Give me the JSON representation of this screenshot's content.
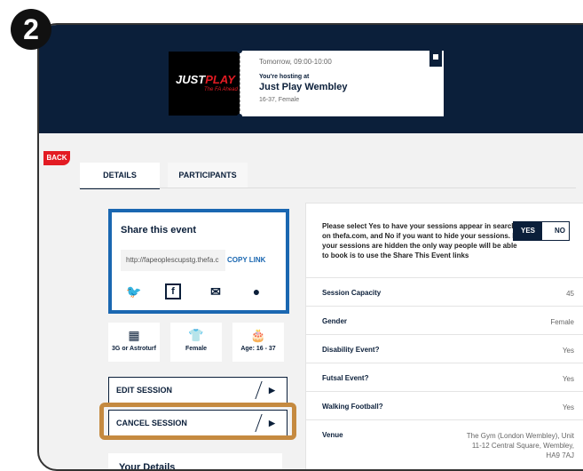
{
  "step_badge": "2",
  "header": {
    "logo_main": "JUST",
    "logo_accent": "PLAY",
    "logo_sub": "The FA Ahead",
    "ticket": {
      "time": "Tomorrow, 09:00-10:00",
      "hosting_label": "You're hosting at",
      "title": "Just Play Wembley",
      "meta": "16-37, Female"
    }
  },
  "nav": {
    "back_label": "BACK",
    "tabs": [
      {
        "label": "DETAILS",
        "active": true
      },
      {
        "label": "PARTICIPANTS",
        "active": false
      }
    ]
  },
  "share": {
    "title": "Share this event",
    "link": "http://fapeoplescupstg.thefa.c",
    "copy_label": "COPY LINK",
    "icons": [
      "twitter-icon",
      "facebook-icon",
      "email-icon",
      "whatsapp-icon"
    ]
  },
  "info_tiles": [
    {
      "icon": "pitch-icon",
      "label": "3G or Astroturf"
    },
    {
      "icon": "shirt-icon",
      "label": "Female"
    },
    {
      "icon": "cake-icon",
      "label": "Age: 16 - 37"
    }
  ],
  "actions": {
    "edit_label": "EDIT SESSION",
    "cancel_label": "CANCEL SESSION"
  },
  "your_details": {
    "title": "Your Details"
  },
  "details_panel": {
    "preference_text": "Please select Yes to have your sessions appear in search on thefa.com, and No if you want to hide your sessions. If your sessions are hidden the only way people will be able to book is to use the Share This Event links",
    "toggle_yes": "YES",
    "toggle_no": "NO",
    "rows": [
      {
        "label": "Session Capacity",
        "value": "45"
      },
      {
        "label": "Gender",
        "value": "Female"
      },
      {
        "label": "Disability Event?",
        "value": "Yes"
      },
      {
        "label": "Futsal Event?",
        "value": "Yes"
      },
      {
        "label": "Walking Football?",
        "value": "Yes"
      },
      {
        "label": "Venue",
        "value": "The Gym (London Wembley), Unit 11-12 Central Square, Wembley, HA9 7AJ"
      }
    ]
  },
  "colors": {
    "navy": "#0b1f3a",
    "red": "#e31b23",
    "blue": "#1a67b1",
    "highlight": "#c58a40"
  }
}
